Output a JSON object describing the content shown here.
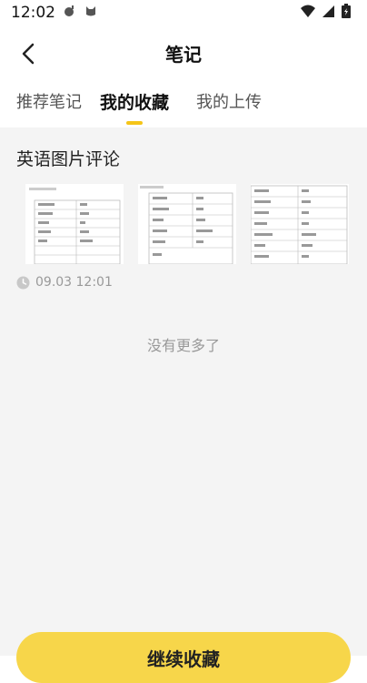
{
  "status_bar": {
    "time": "12:02",
    "left_icons": [
      "bomb-icon",
      "cat-icon"
    ],
    "right_icons": [
      "wifi-icon",
      "signal-icon",
      "battery-icon"
    ]
  },
  "header": {
    "title": "笔记"
  },
  "tabs": [
    {
      "label": "推荐笔记",
      "active": false
    },
    {
      "label": "我的收藏",
      "active": true
    },
    {
      "label": "我的上传",
      "active": false
    }
  ],
  "note": {
    "title": "英语图片评论",
    "timestamp": "09.03 12:01"
  },
  "list_end_text": "没有更多了",
  "bottom_button": {
    "label": "继续收藏"
  },
  "colors": {
    "accent": "#f5c518",
    "button": "#f7d64a"
  }
}
